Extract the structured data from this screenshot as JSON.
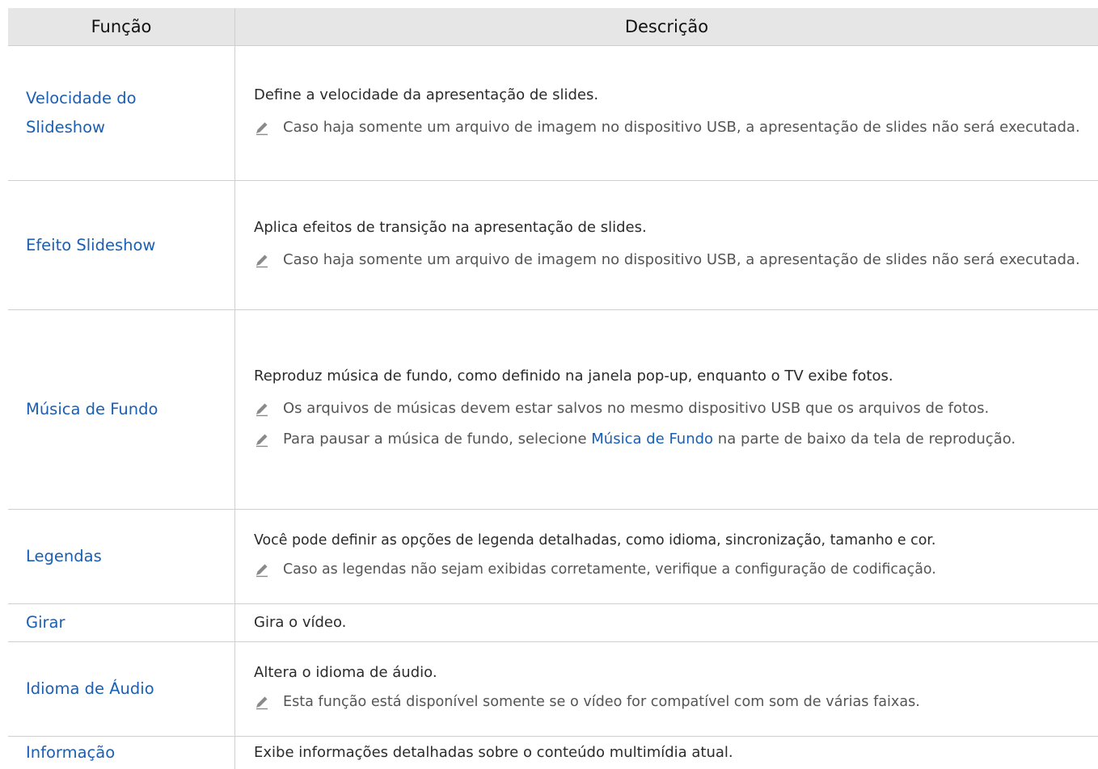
{
  "header": {
    "col_function": "Função",
    "col_description": "Descrição"
  },
  "rows": [
    {
      "function": "Velocidade do Slideshow",
      "description": "Define a velocidade da apresentação de slides.",
      "note": "Caso haja somente um arquivo de imagem no dispositivo USB, a apresentação de slides não será executada."
    },
    {
      "function": "Efeito Slideshow",
      "description": "Aplica efeitos de transição na apresentação de slides.",
      "note": "Caso haja somente um arquivo de imagem no dispositivo USB, a apresentação de slides não será executada."
    },
    {
      "function": "Música de Fundo",
      "description": "Reproduz música de fundo, como definido na janela pop-up, enquanto o TV exibe fotos.",
      "note1": "Os arquivos de músicas devem estar salvos no mesmo dispositivo USB que os arquivos de fotos.",
      "note2_before": "Para pausar a música de fundo, selecione ",
      "note2_link": "Música de Fundo",
      "note2_after": " na parte de baixo da tela de reprodução."
    },
    {
      "function": "Legendas",
      "description": "Você pode definir as opções de legenda detalhadas, como idioma, sincronização, tamanho e cor.",
      "note": "Caso as legendas não sejam exibidas corretamente, verifique a configuração de codificação."
    },
    {
      "function": "Girar",
      "description": "Gira o vídeo."
    },
    {
      "function": "Idioma de Áudio",
      "description": "Altera o idioma de áudio.",
      "note": "Esta função está disponível somente se o vídeo for compatível com som de várias faixas."
    },
    {
      "function": "Informação",
      "description": "Exibe informações detalhadas sobre o conteúdo multimídia atual."
    }
  ],
  "icons": {
    "note": "pencil-note-icon"
  },
  "colors": {
    "link": "#1a5fb4",
    "header_bg": "#e6e6e6",
    "border": "#cfcfcf"
  }
}
